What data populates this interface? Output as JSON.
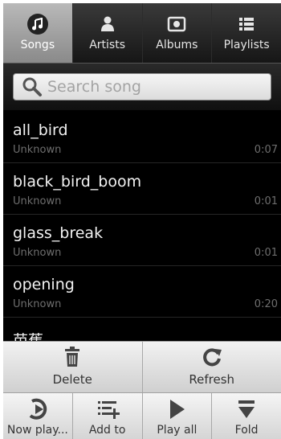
{
  "tabs": [
    {
      "label": "Songs",
      "icon": "music-note-icon",
      "active": true
    },
    {
      "label": "Artists",
      "icon": "person-icon",
      "active": false
    },
    {
      "label": "Albums",
      "icon": "album-icon",
      "active": false
    },
    {
      "label": "Playlists",
      "icon": "list-icon",
      "active": false
    }
  ],
  "search": {
    "placeholder": "Search song"
  },
  "songs": [
    {
      "title": "all_bird",
      "artist": "Unknown",
      "duration": "0:07"
    },
    {
      "title": "black_bird_boom",
      "artist": "Unknown",
      "duration": "0:01"
    },
    {
      "title": "glass_break",
      "artist": "Unknown",
      "duration": "0:01"
    },
    {
      "title": "opening",
      "artist": "Unknown",
      "duration": "0:20"
    },
    {
      "title": "芭蕉",
      "artist": "",
      "duration": ""
    }
  ],
  "actions": {
    "delete": "Delete",
    "refresh": "Refresh"
  },
  "bottom": {
    "now_playing": "Now play...",
    "add_to": "Add to",
    "play_all": "Play all",
    "fold": "Fold"
  },
  "colors": {
    "background": "#000000",
    "text": "#f2f2f2",
    "subtext": "#6e6e6e"
  }
}
